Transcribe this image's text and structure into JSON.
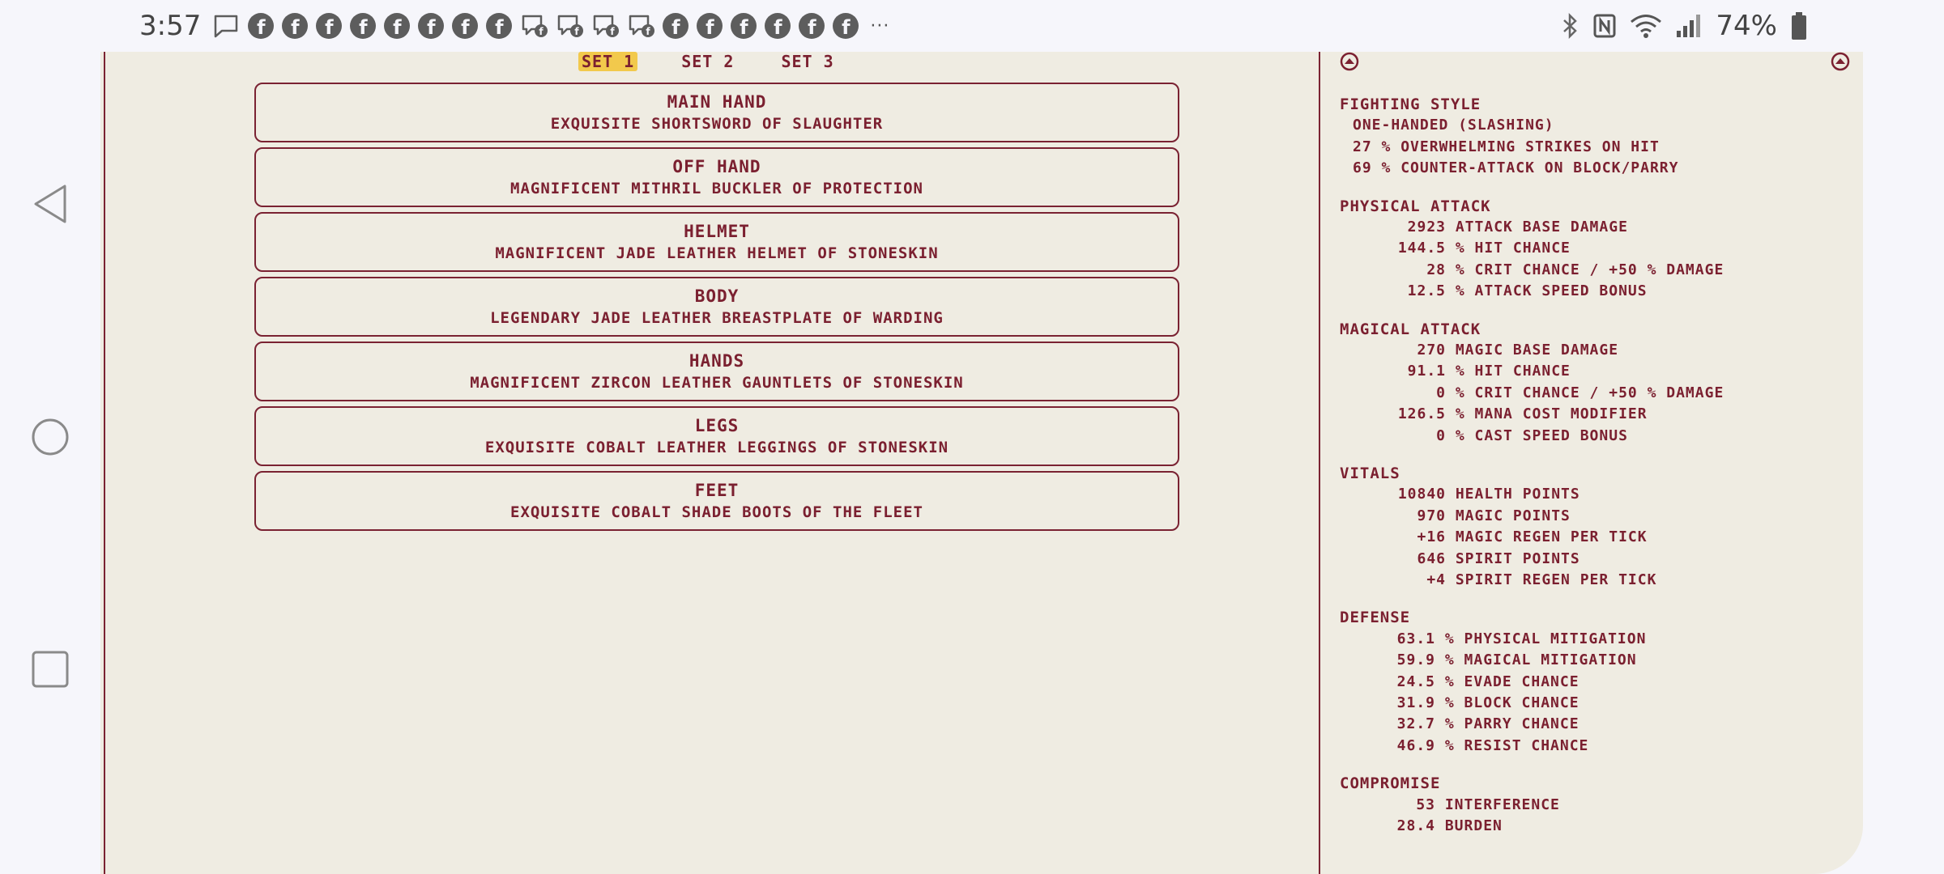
{
  "statusbar": {
    "time": "3:57",
    "battery_percent": "74%",
    "notification_icons": [
      "message-icon",
      "facebook-icon",
      "facebook-icon",
      "facebook-icon",
      "facebook-icon",
      "facebook-icon",
      "facebook-icon",
      "facebook-icon",
      "facebook-icon",
      "messenger-icon",
      "messenger-icon",
      "messenger-icon",
      "messenger-icon",
      "facebook-icon",
      "facebook-icon",
      "facebook-icon",
      "facebook-icon",
      "facebook-icon",
      "facebook-icon"
    ],
    "more_indicator": "···",
    "right_icons": [
      "bluetooth-icon",
      "nfc-icon",
      "wifi-icon",
      "signal-icon",
      "battery-icon"
    ]
  },
  "nav": [
    "back-icon",
    "home-icon",
    "recents-icon"
  ],
  "set_tabs": [
    {
      "label": "SET 1",
      "active": true
    },
    {
      "label": "SET 2",
      "active": false
    },
    {
      "label": "SET 3",
      "active": false
    }
  ],
  "slots": [
    {
      "name": "MAIN HAND",
      "item": "EXQUISITE SHORTSWORD OF SLAUGHTER"
    },
    {
      "name": "OFF HAND",
      "item": "MAGNIFICENT MITHRIL BUCKLER OF PROTECTION"
    },
    {
      "name": "HELMET",
      "item": "MAGNIFICENT JADE LEATHER HELMET OF STONESKIN"
    },
    {
      "name": "BODY",
      "item": "LEGENDARY JADE LEATHER BREASTPLATE OF WARDING"
    },
    {
      "name": "HANDS",
      "item": "MAGNIFICENT ZIRCON LEATHER GAUNTLETS OF STONESKIN"
    },
    {
      "name": "LEGS",
      "item": "EXQUISITE COBALT LEATHER LEGGINGS OF STONESKIN"
    },
    {
      "name": "FEET",
      "item": "EXQUISITE COBALT SHADE BOOTS OF THE FLEET"
    }
  ],
  "stats": {
    "fighting_style": {
      "title": "FIGHTING STYLE",
      "style": "ONE-HANDED (SLASHING)",
      "rows": [
        {
          "value": "27",
          "label": "% OVERWHELMING STRIKES ON HIT"
        },
        {
          "value": "69",
          "label": "% COUNTER-ATTACK ON BLOCK/PARRY"
        }
      ]
    },
    "physical_attack": {
      "title": "PHYSICAL ATTACK",
      "rows": [
        {
          "value": "2923",
          "label": "ATTACK BASE DAMAGE"
        },
        {
          "value": "144.5",
          "label": "% HIT CHANCE"
        },
        {
          "value": "28",
          "label": "% CRIT CHANCE / +50 % DAMAGE"
        },
        {
          "value": "12.5",
          "label": "% ATTACK SPEED BONUS"
        }
      ]
    },
    "magical_attack": {
      "title": "MAGICAL ATTACK",
      "rows": [
        {
          "value": "270",
          "label": "MAGIC BASE DAMAGE"
        },
        {
          "value": "91.1",
          "label": "% HIT CHANCE"
        },
        {
          "value": "0",
          "label": "% CRIT CHANCE / +50 % DAMAGE"
        },
        {
          "value": "126.5",
          "label": "% MANA COST MODIFIER"
        },
        {
          "value": "0",
          "label": "% CAST SPEED BONUS"
        }
      ]
    },
    "vitals": {
      "title": "VITALS",
      "rows": [
        {
          "value": "10840",
          "label": "HEALTH POINTS"
        },
        {
          "value": "970",
          "label": "MAGIC POINTS"
        },
        {
          "value": "+16",
          "label": "MAGIC REGEN PER TICK"
        },
        {
          "value": "646",
          "label": "SPIRIT POINTS"
        },
        {
          "value": "+4",
          "label": "SPIRIT REGEN PER TICK"
        }
      ]
    },
    "defense": {
      "title": "DEFENSE",
      "rows": [
        {
          "value": "63.1",
          "label": "% PHYSICAL MITIGATION"
        },
        {
          "value": "59.9",
          "label": "% MAGICAL MITIGATION"
        },
        {
          "value": "24.5",
          "label": "% EVADE CHANCE"
        },
        {
          "value": "31.9",
          "label": "% BLOCK CHANCE"
        },
        {
          "value": "32.7",
          "label": "% PARRY CHANCE"
        },
        {
          "value": "46.9",
          "label": "% RESIST CHANCE"
        }
      ]
    },
    "compromise": {
      "title": "COMPROMISE",
      "rows": [
        {
          "value": "53",
          "label": "INTERFERENCE"
        },
        {
          "value": "28.4",
          "label": "BURDEN"
        }
      ]
    }
  },
  "colors": {
    "accent": "#7b2030",
    "panel_bg": "#efece2",
    "active_tab_bg": "#f2c94c"
  }
}
